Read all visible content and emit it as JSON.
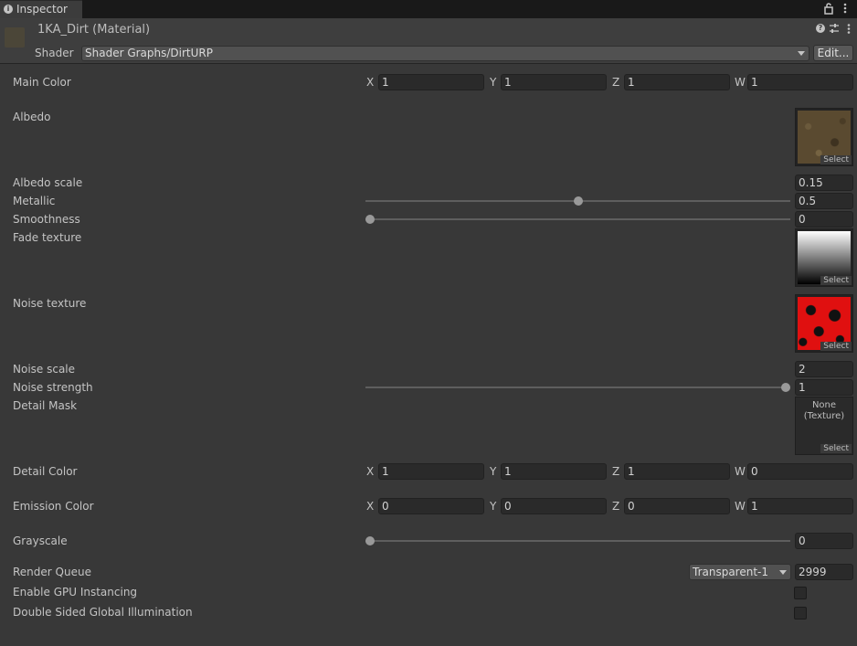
{
  "tab": {
    "title": "Inspector"
  },
  "header": {
    "material_name": "1KA_Dirt (Material)",
    "shader_label": "Shader",
    "shader_value": "Shader Graphs/DirtURP",
    "edit_label": "Edit..."
  },
  "properties": {
    "main_color": {
      "label": "Main Color",
      "x": "1",
      "y": "1",
      "z": "1",
      "w": "1"
    },
    "albedo": {
      "label": "Albedo",
      "select": "Select"
    },
    "albedo_scale": {
      "label": "Albedo scale",
      "value": "0.15"
    },
    "metallic": {
      "label": "Metallic",
      "value": "0.5",
      "fraction": 0.5
    },
    "smoothness": {
      "label": "Smoothness",
      "value": "0",
      "fraction": 0
    },
    "fade_texture": {
      "label": "Fade texture",
      "select": "Select"
    },
    "noise_texture": {
      "label": "Noise texture",
      "select": "Select"
    },
    "noise_scale": {
      "label": "Noise scale",
      "value": "2"
    },
    "noise_strength": {
      "label": "Noise strength",
      "value": "1",
      "fraction": 1
    },
    "detail_mask": {
      "label": "Detail Mask",
      "none_line1": "None",
      "none_line2": "(Texture)",
      "select": "Select"
    },
    "detail_color": {
      "label": "Detail Color",
      "x": "1",
      "y": "1",
      "z": "1",
      "w": "0"
    },
    "emission_color": {
      "label": "Emission Color",
      "x": "0",
      "y": "0",
      "z": "0",
      "w": "1"
    },
    "grayscale": {
      "label": "Grayscale",
      "value": "0",
      "fraction": 0
    },
    "render_queue": {
      "label": "Render Queue",
      "dropdown": "Transparent-1",
      "value": "2999"
    },
    "gpu_instancing": {
      "label": "Enable GPU Instancing",
      "checked": false
    },
    "double_sided_gi": {
      "label": "Double Sided Global Illumination",
      "checked": false
    }
  },
  "axis_labels": {
    "x": "X",
    "y": "Y",
    "z": "Z",
    "w": "W"
  },
  "colors": {
    "background": "#383838",
    "field": "#2a2a2a",
    "noise_red": "#e01010",
    "albedo_brown": "#5a4a30"
  }
}
